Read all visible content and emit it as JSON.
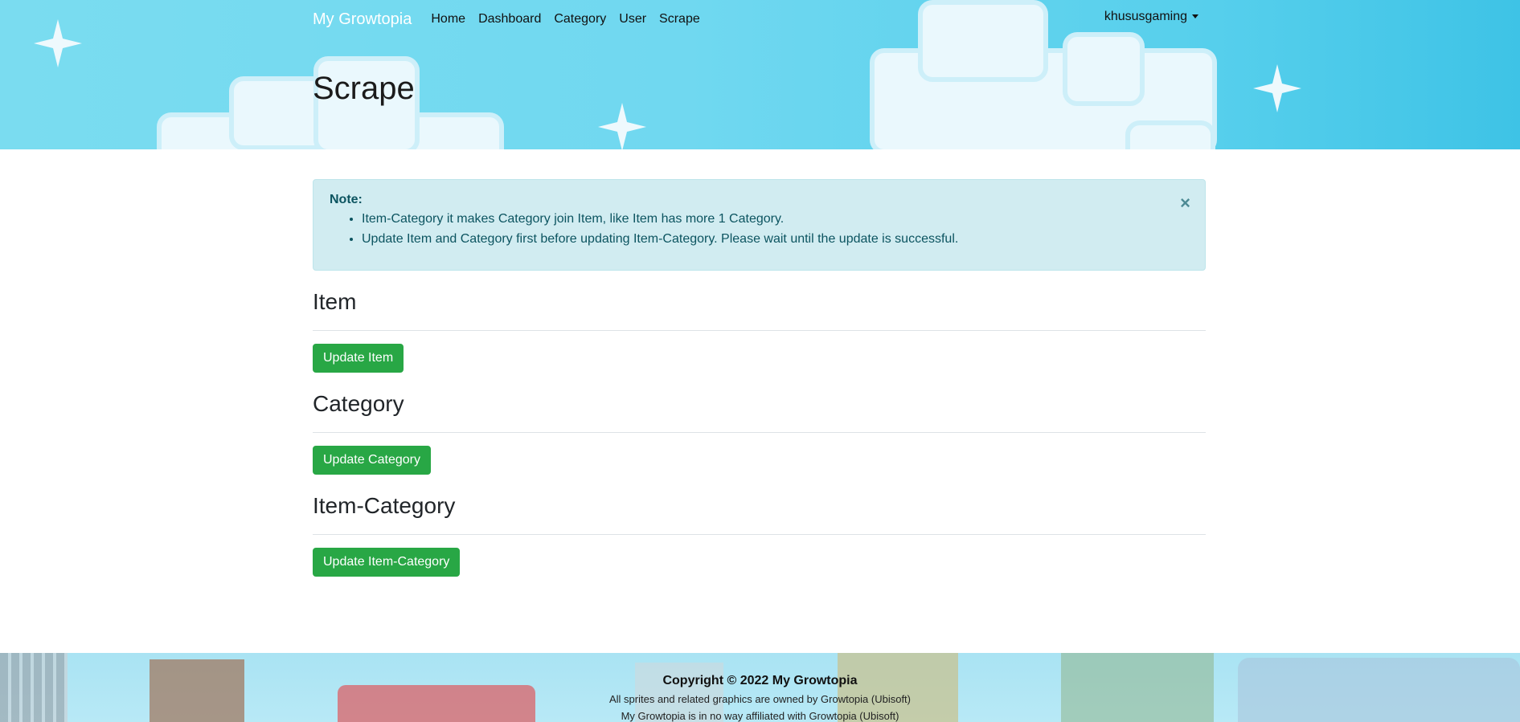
{
  "navbar": {
    "brand": "My Growtopia",
    "links": [
      "Home",
      "Dashboard",
      "Category",
      "User",
      "Scrape"
    ],
    "user": "khususgaming"
  },
  "page": {
    "title": "Scrape"
  },
  "alert": {
    "title": "Note:",
    "items": [
      "Item-Category it makes Category join Item, like Item has more 1 Category.",
      "Update Item and Category first before updating Item-Category. Please wait until the update is successful."
    ],
    "close": "×"
  },
  "sections": [
    {
      "title": "Item",
      "button": "Update Item"
    },
    {
      "title": "Category",
      "button": "Update Category"
    },
    {
      "title": "Item-Category",
      "button": "Update Item-Category"
    }
  ],
  "footer": {
    "copyright": "Copyright © 2022 My Growtopia",
    "line1": "All sprites and related graphics are owned by Growtopia (Ubisoft)",
    "line2": "My Growtopia is in no way affiliated with Growtopia (Ubisoft)"
  },
  "colors": {
    "button_green": "#28a745",
    "alert_bg": "#d1ecf1",
    "alert_text": "#0c5460",
    "header_sky": "#70d8f0"
  }
}
